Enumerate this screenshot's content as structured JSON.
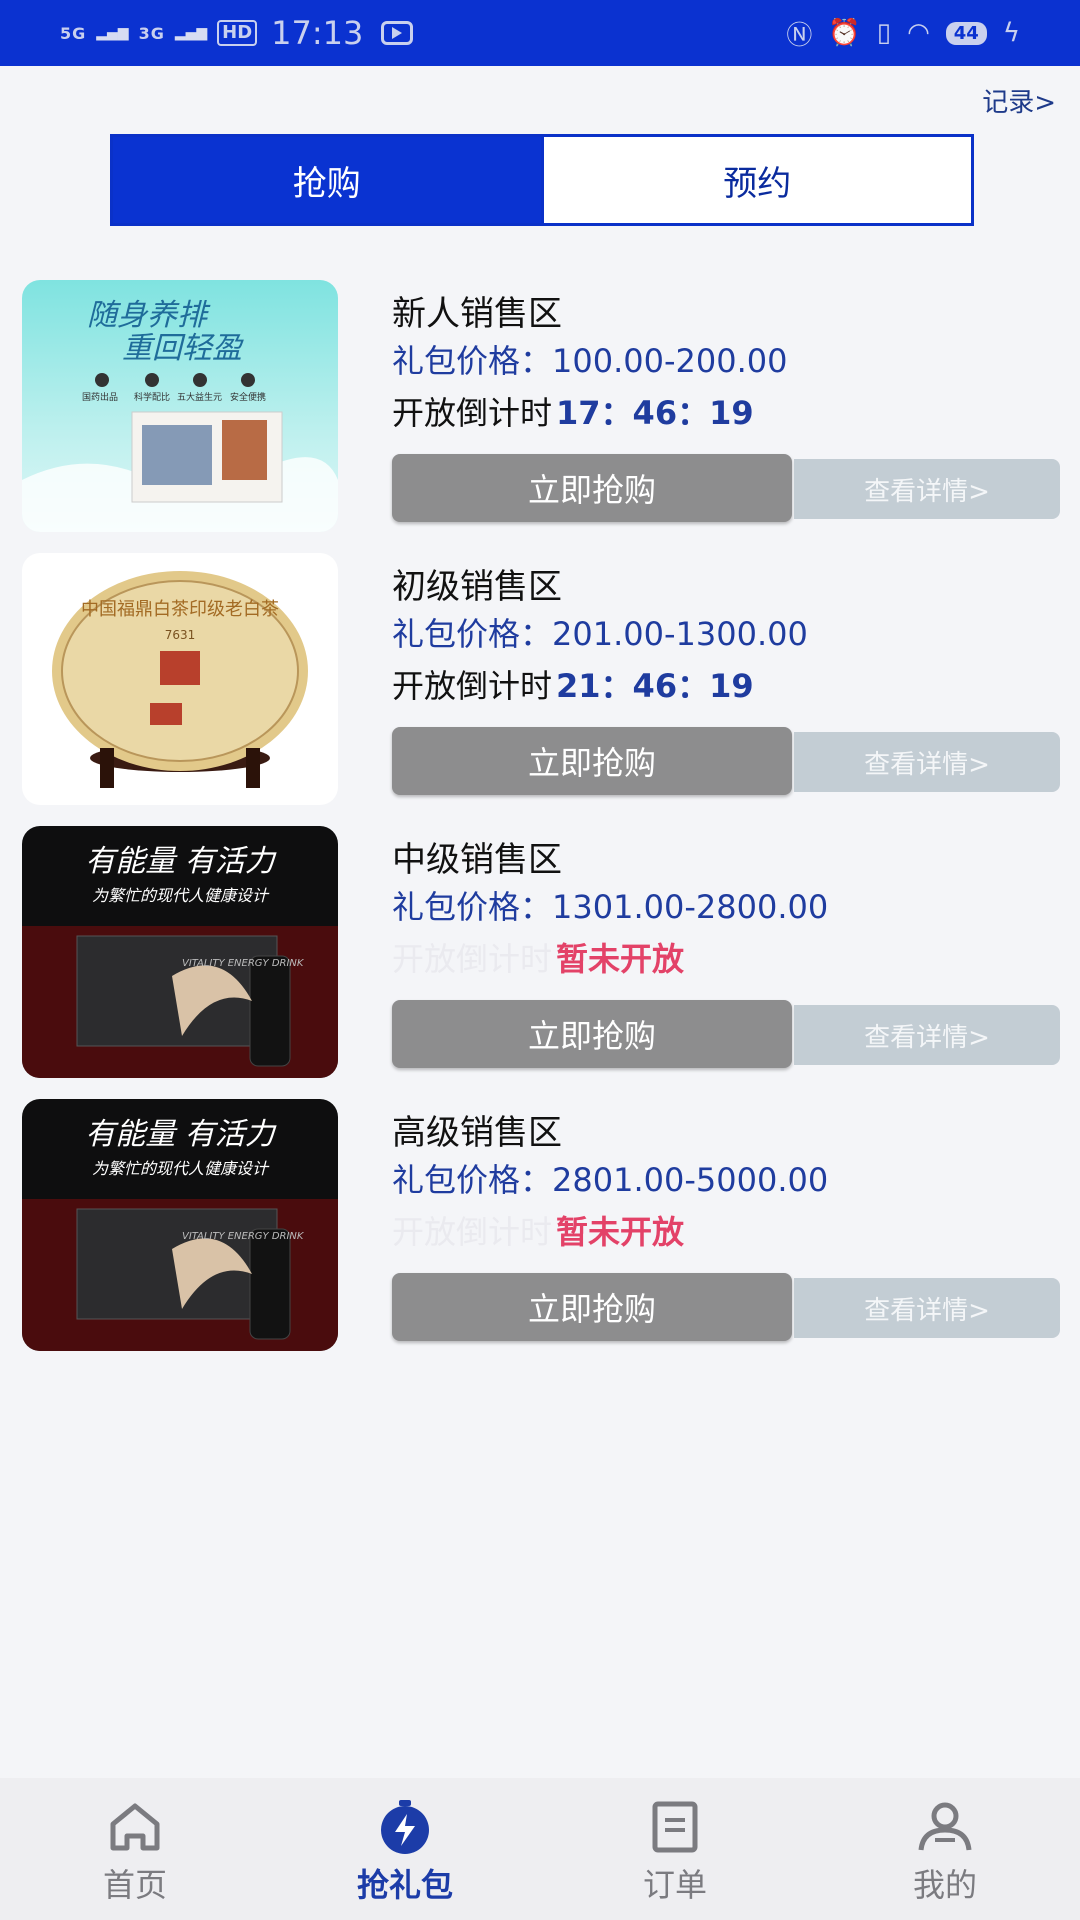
{
  "status_bar": {
    "net1": "5G",
    "net2": "3G",
    "hd": "HD",
    "time": "17:13",
    "battery": "44"
  },
  "header": {
    "record_link": "记录>"
  },
  "tabs": [
    {
      "label": "抢购",
      "active": true
    },
    {
      "label": "预约",
      "active": false
    }
  ],
  "products": [
    {
      "title": "新人销售区",
      "price": "礼包价格：100.00-200.00",
      "countdown_label": "开放倒计时",
      "countdown_value": "17：46：19",
      "open": true,
      "buy_label": "立即抢购",
      "detail_label": "查看详情>",
      "image_text": [
        "随身养排",
        "重回轻盈"
      ],
      "image_icons": [
        "国药出品",
        "科学配比",
        "五大益生元",
        "安全便携"
      ]
    },
    {
      "title": "初级销售区",
      "price": "礼包价格：201.00-1300.00",
      "countdown_label": "开放倒计时",
      "countdown_value": "21：46：19",
      "open": true,
      "buy_label": "立即抢购",
      "detail_label": "查看详情>",
      "image_text": [
        "中国福鼎白茶印级老白茶",
        "7631"
      ]
    },
    {
      "title": "中级销售区",
      "price": "礼包价格：1301.00-2800.00",
      "countdown_label": "开放倒计时",
      "countdown_value": "暂未开放",
      "open": false,
      "buy_label": "立即抢购",
      "detail_label": "查看详情>",
      "image_text": [
        "有能量 有活力",
        "为繁忙的现代人健康设计",
        "VITALITY ENERGY DRINK"
      ]
    },
    {
      "title": "高级销售区",
      "price": "礼包价格：2801.00-5000.00",
      "countdown_label": "开放倒计时",
      "countdown_value": "暂未开放",
      "open": false,
      "buy_label": "立即抢购",
      "detail_label": "查看详情>",
      "image_text": [
        "有能量 有活力",
        "为繁忙的现代人健康设计",
        "VITALITY ENERGY DRINK"
      ]
    }
  ],
  "tabbar": [
    {
      "label": "首页",
      "icon": "home-icon",
      "active": false
    },
    {
      "label": "抢礼包",
      "icon": "flash-sale-icon",
      "active": true
    },
    {
      "label": "订单",
      "icon": "order-icon",
      "active": false
    },
    {
      "label": "我的",
      "icon": "user-icon",
      "active": false
    }
  ],
  "colors": {
    "primary": "#0a33d1",
    "price_blue": "#1f3c9f",
    "closed_red": "#e34268",
    "buy_gray": "#8d8d8e",
    "detail_gray": "#c3cdd4"
  }
}
